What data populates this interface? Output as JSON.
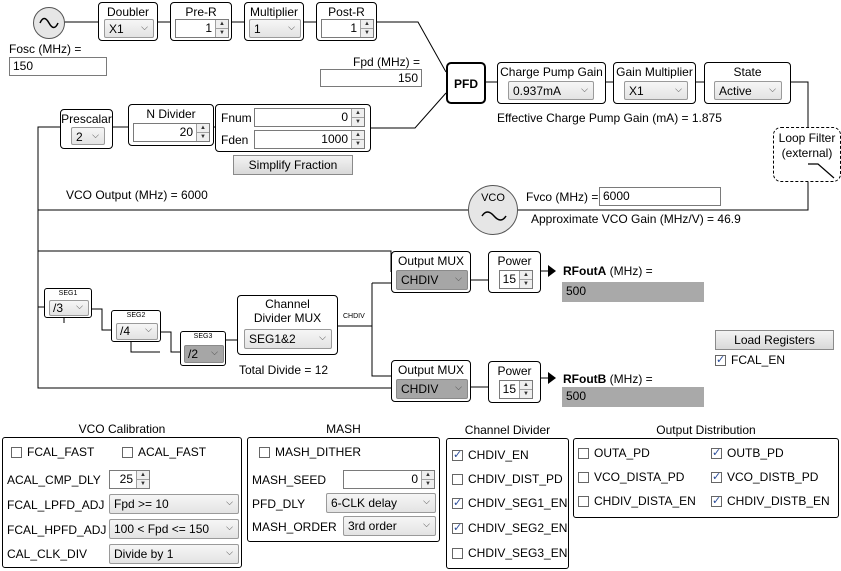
{
  "fosc": {
    "label": "Fosc (MHz) =",
    "value": "150"
  },
  "doubler": {
    "title": "Doubler",
    "value": "X1"
  },
  "pre_r": {
    "title": "Pre-R",
    "value": "1"
  },
  "multiplier": {
    "title": "Multiplier",
    "value": "1"
  },
  "post_r": {
    "title": "Post-R",
    "value": "1"
  },
  "fpd": {
    "label": "Fpd (MHz) =",
    "value": "150"
  },
  "pfd": {
    "label": "PFD"
  },
  "charge_pump_gain": {
    "title": "Charge Pump Gain",
    "value": "0.937mA"
  },
  "gain_multiplier": {
    "title": "Gain Multiplier",
    "value": "X1"
  },
  "state": {
    "title": "State",
    "value": "Active"
  },
  "effective_cp_gain": {
    "label": "Effective Charge Pump Gain (mA) =",
    "value": "1.875"
  },
  "loop_filter": {
    "line1": "Loop Filter",
    "line2": "(external)"
  },
  "prescalar": {
    "title": "Prescalar",
    "value": "2"
  },
  "n_divider": {
    "title": "N Divider",
    "value": "20"
  },
  "fraction": {
    "fnum_label": "Fnum",
    "fnum_value": "0",
    "fden_label": "Fden",
    "fden_value": "1000",
    "simplify_label": "Simplify Fraction"
  },
  "vco_output": {
    "label": "VCO Output (MHz) =",
    "value": "6000"
  },
  "vco": {
    "label": "VCO",
    "fvco_label": "Fvco (MHz) =",
    "fvco_value": "6000",
    "gain_label": "Approximate VCO Gain (MHz/V) =",
    "gain_value": "46.9"
  },
  "seg1": {
    "title": "SEG1",
    "value": "/3"
  },
  "seg2": {
    "title": "SEG2",
    "value": "/4"
  },
  "seg3": {
    "title": "SEG3",
    "value": "/2"
  },
  "channel_mux": {
    "title1": "Channel",
    "title2": "Divider MUX",
    "value": "SEG1&2"
  },
  "total_divide": {
    "label": "Total Divide =",
    "value": "12"
  },
  "chdiv_label": "CHDIV",
  "output_a": {
    "mux_title": "Output MUX",
    "mux_value": "CHDIV",
    "power_title": "Power",
    "power_value": "15",
    "rf_name": "RFoutA",
    "rf_unit": "(MHz) =",
    "rf_value": "500"
  },
  "output_b": {
    "mux_title": "Output MUX",
    "mux_value": "CHDIV",
    "power_title": "Power",
    "power_value": "15",
    "rf_name": "RFoutB",
    "rf_unit": "(MHz) =",
    "rf_value": "500"
  },
  "load_registers_label": "Load Registers",
  "fcal_en": {
    "label": "FCAL_EN",
    "checked": true
  },
  "vco_calibration": {
    "title": "VCO Calibration",
    "fcal_fast": {
      "label": "FCAL_FAST",
      "checked": false
    },
    "acal_fast": {
      "label": "ACAL_FAST",
      "checked": false
    },
    "acal_cmp_dly": {
      "label": "ACAL_CMP_DLY",
      "value": "25"
    },
    "fcal_lpfd_adj": {
      "label": "FCAL_LPFD_ADJ",
      "value": "Fpd >= 10"
    },
    "fcal_hpfd_adj": {
      "label": "FCAL_HPFD_ADJ",
      "value": "100 < Fpd <= 150"
    },
    "cal_clk_div": {
      "label": "CAL_CLK_DIV",
      "value": "Divide by 1"
    }
  },
  "mash": {
    "title": "MASH",
    "mash_dither": {
      "label": "MASH_DITHER",
      "checked": false
    },
    "mash_seed": {
      "label": "MASH_SEED",
      "value": "0"
    },
    "pfd_dly": {
      "label": "PFD_DLY",
      "value": "6-CLK delay"
    },
    "mash_order": {
      "label": "MASH_ORDER",
      "value": "3rd order"
    }
  },
  "channel_divider": {
    "title": "Channel Divider",
    "items": [
      {
        "label": "CHDIV_EN",
        "checked": true
      },
      {
        "label": "CHDIV_DIST_PD",
        "checked": false
      },
      {
        "label": "CHDIV_SEG1_EN",
        "checked": true
      },
      {
        "label": "CHDIV_SEG2_EN",
        "checked": true
      },
      {
        "label": "CHDIV_SEG3_EN",
        "checked": false
      }
    ]
  },
  "output_distribution": {
    "title": "Output Distribution",
    "items": [
      {
        "label": "OUTA_PD",
        "checked": false
      },
      {
        "label": "OUTB_PD",
        "checked": true
      },
      {
        "label": "VCO_DISTA_PD",
        "checked": false
      },
      {
        "label": "VCO_DISTB_PD",
        "checked": true
      },
      {
        "label": "CHDIV_DISTA_EN",
        "checked": false
      },
      {
        "label": "CHDIV_DISTB_EN",
        "checked": true
      }
    ]
  }
}
